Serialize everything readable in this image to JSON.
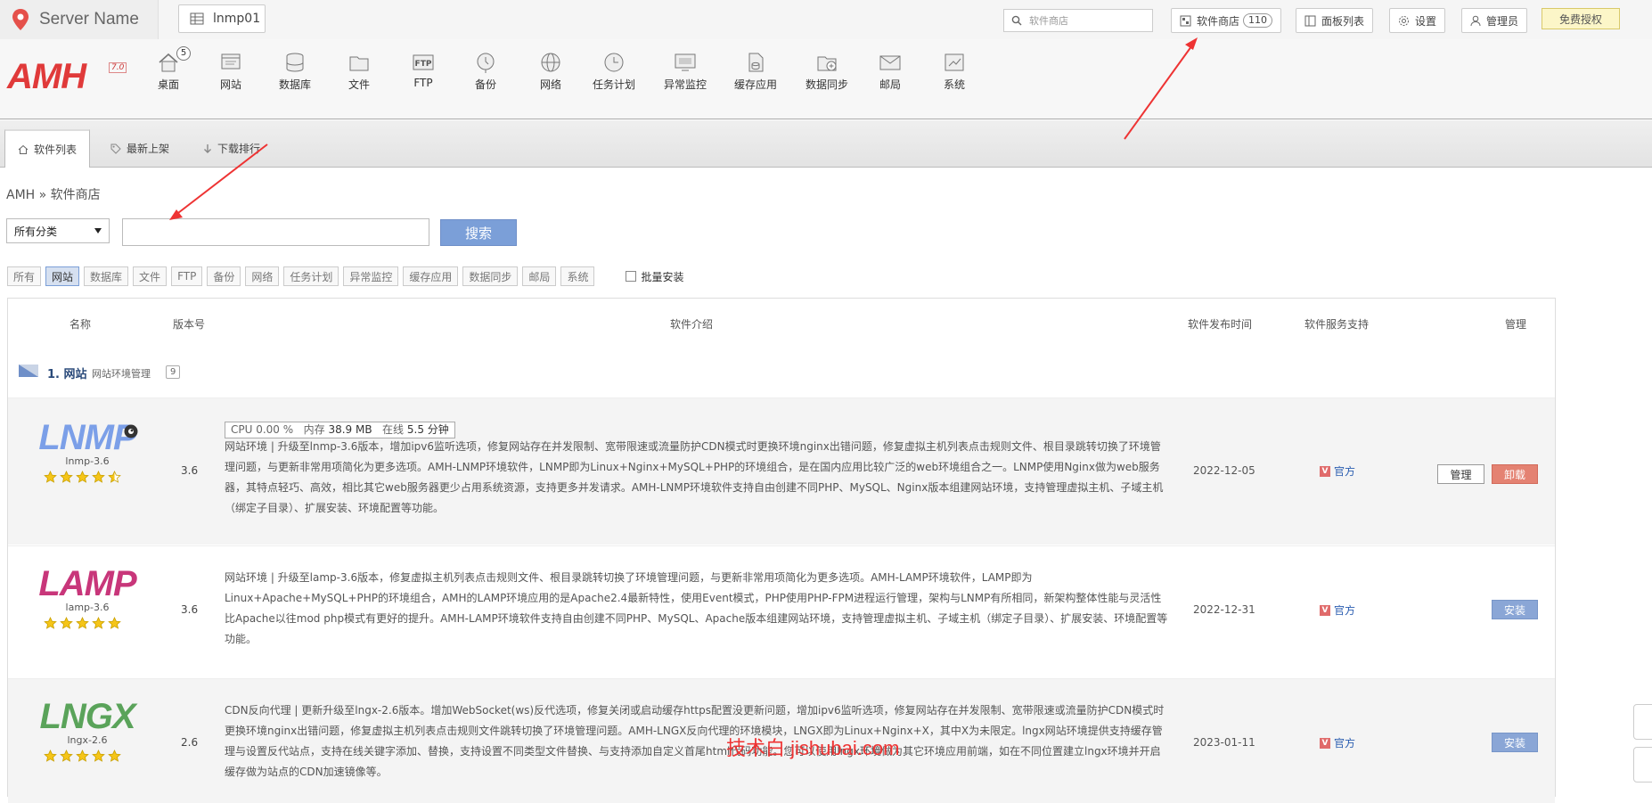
{
  "topbar": {
    "server_name": "Server Name",
    "server_button": "lnmp01",
    "search_placeholder": "软件商店",
    "store_label": "软件商店",
    "store_count": "110",
    "panel_list": "面板列表",
    "settings": "设置",
    "admin": "管理员",
    "free_license": "免费授权"
  },
  "brand": {
    "logo": "AMH",
    "version": "7.0"
  },
  "nav": {
    "desktop_badge": "5",
    "items": [
      "桌面",
      "网站",
      "数据库",
      "文件",
      "FTP",
      "备份",
      "网络",
      "任务计划",
      "异常监控",
      "缓存应用",
      "数据同步",
      "邮局",
      "系统"
    ]
  },
  "tabs": [
    "软件列表",
    "最新上架",
    "下载排行"
  ],
  "breadcrumb": "AMH » 软件商店",
  "search": {
    "category": "所有分类",
    "button": "搜索",
    "value": ""
  },
  "filters": [
    "所有",
    "网站",
    "数据库",
    "文件",
    "FTP",
    "备份",
    "网络",
    "任务计划",
    "异常监控",
    "缓存应用",
    "数据同步",
    "邮局",
    "系统"
  ],
  "batch_install": "批量安装",
  "table": {
    "headers": {
      "name": "名称",
      "version": "版本号",
      "intro": "软件介绍",
      "release": "软件发布时间",
      "support": "软件服务支持",
      "manage": "管理"
    },
    "group": {
      "title": "1. 网站",
      "subtitle": "网站环境管理",
      "count": "9"
    },
    "rows": [
      {
        "logo": "LNMP",
        "name": "lnmp-3.6",
        "version": "3.6",
        "rating": 4.5,
        "stats": {
          "cpu": "CPU 0.00 %",
          "mem_label": "内存",
          "mem": "38.9 MB",
          "online_label": "在线",
          "online": "5.5 分钟"
        },
        "desc": "网站环境 | 升级至lnmp-3.6版本，增加ipv6监听选项，修复网站存在并发限制、宽带限速或流量防护CDN模式时更换环境nginx出错问题，修复虚拟主机列表点击规则文件、根目录跳转切换了环境管理问题，与更新非常用项简化为更多选项。AMH-LNMP环境软件，LNMP即为Linux+Nginx+MySQL+PHP的环境组合，是在国内应用比较广泛的web环境组合之一。LNMP使用Nginx做为web服务器，其特点轻巧、高效，相比其它web服务器更少占用系统资源，支持更多并发请求。AMH-LNMP环境软件支持自由创建不同PHP、MySQL、Nginx版本组建网站环境，支持管理虚拟主机、子域主机（绑定子目录）、扩展安装、环境配置等功能。",
        "date": "2022-12-05",
        "support": "官方",
        "manage": "管理",
        "action": "卸载"
      },
      {
        "logo": "LAMP",
        "name": "lamp-3.6",
        "version": "3.6",
        "rating": 5,
        "desc": "网站环境 | 升级至lamp-3.6版本，修复虚拟主机列表点击规则文件、根目录跳转切换了环境管理问题，与更新非常用项简化为更多选项。AMH-LAMP环境软件，LAMP即为Linux+Apache+MySQL+PHP的环境组合，AMH的LAMP环境应用的是Apache2.4最新特性，使用Event模式，PHP使用PHP-FPM进程运行管理，架构与LNMP有所相同，新架构整体性能与灵活性比Apache以往mod php模式有更好的提升。AMH-LAMP环境软件支持自由创建不同PHP、MySQL、Apache版本组建网站环境，支持管理虚拟主机、子域主机（绑定子目录）、扩展安装、环境配置等功能。",
        "date": "2022-12-31",
        "support": "官方",
        "action": "安装"
      },
      {
        "logo": "LNGX",
        "name": "lngx-2.6",
        "version": "2.6",
        "rating": 5,
        "desc": "CDN反向代理 | 更新升级至lngx-2.6版本。增加WebSocket(ws)反代选项，修复关闭或启动缓存https配置没更新问题，增加ipv6监听选项，修复网站存在并发限制、宽带限速或流量防护CDN模式时更换环境nginx出错问题，修复虚拟主机列表点击规则文件跳转切换了环境管理问题。AMH-LNGX反向代理的环境模块，LNGX即为Linux+Nginx+X，其中X为未限定。lngx网站环境提供支持缓存管理与设置反代站点，支持在线关键字添加、替换，支持设置不同类型文件替换、与支持添加自定义首尾html代码功能。您可以使用lngx环境做为其它环境应用前端，如在不同位置建立lngx环境并开启缓存做为站点的CDN加速镜像等。",
        "date": "2023-01-11",
        "support": "官方",
        "action": "安装"
      }
    ]
  },
  "watermark": "技术白 jishubai.com",
  "colors": {
    "accent": "#7b9fd8",
    "uninstall": "#e48272",
    "logo_red": "#e03a3a",
    "lnmp": "#7b9fe8",
    "lngx": "#5aa35a"
  }
}
